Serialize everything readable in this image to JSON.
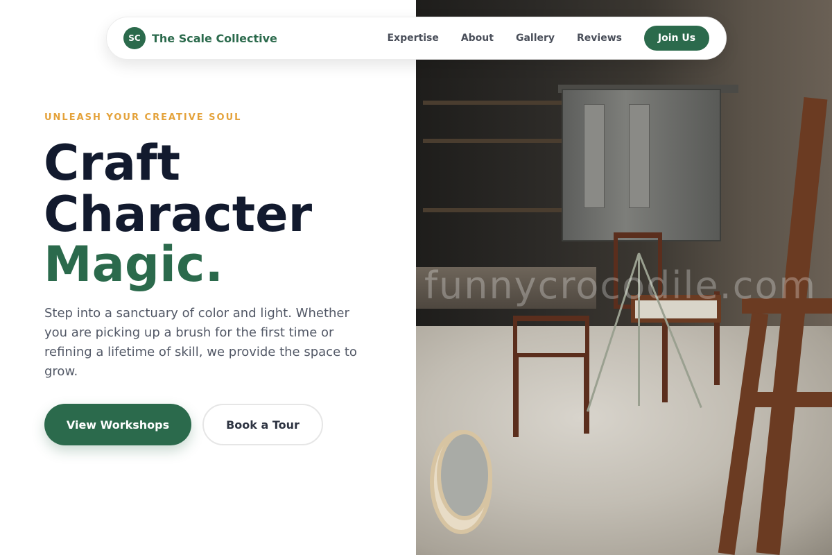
{
  "brand": {
    "initials": "SC",
    "name": "The Scale Collective"
  },
  "nav": {
    "links": [
      "Expertise",
      "About",
      "Gallery",
      "Reviews"
    ],
    "cta": "Join Us"
  },
  "hero": {
    "eyebrow": "UNLEASH YOUR CREATIVE SOUL",
    "headline_line1": "Craft",
    "headline_line2": "Character",
    "headline_line3": "Magic.",
    "lede": "Step into a sanctuary of color and light. Whether you are picking up a brush for the first time or refining a lifetime of skill, we provide the space to grow.",
    "primary_button": "View Workshops",
    "secondary_button": "Book a Tour"
  },
  "photo": {
    "watermark": "funnycrocodile.com"
  },
  "colors": {
    "brand_green": "#2b6a4c",
    "accent_amber": "#e4a23a",
    "heading_navy": "#121a2e"
  }
}
